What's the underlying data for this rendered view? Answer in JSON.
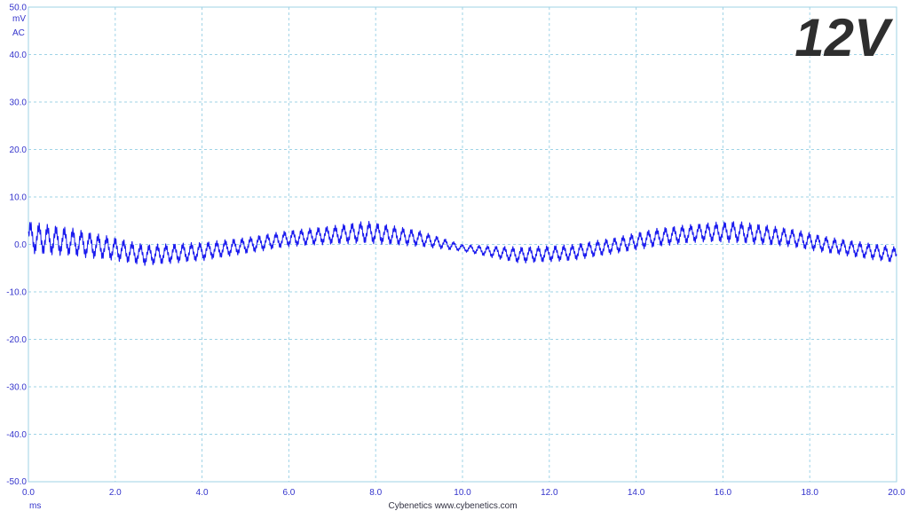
{
  "chart_data": {
    "type": "line",
    "title": "12V",
    "xlabel": "ms",
    "ylabel": "mV",
    "ylabel_mode": "AC",
    "xlim": [
      0,
      20
    ],
    "ylim": [
      -50,
      50
    ],
    "x_ticks": [
      "0.0",
      "2.0",
      "4.0",
      "6.0",
      "8.0",
      "10.0",
      "12.0",
      "14.0",
      "16.0",
      "18.0",
      "20.0"
    ],
    "y_ticks": [
      "50.0",
      "40.0",
      "30.0",
      "20.0",
      "10.0",
      "0.0",
      "-10.0",
      "-20.0",
      "-30.0",
      "-40.0",
      "-50.0"
    ],
    "grid": true,
    "footer": "Cybenetics  www.cybenetics.com",
    "series_color": "#1a1aee",
    "grid_color": "#9fd3e6",
    "ripple_envelope": {
      "x": [
        0.0,
        1.0,
        2.0,
        2.7,
        4.0,
        5.0,
        6.0,
        7.0,
        7.8,
        9.0,
        10.0,
        11.3,
        12.5,
        13.5,
        14.5,
        15.5,
        16.3,
        17.5,
        18.5,
        20.0
      ],
      "low": [
        -2.0,
        -2.5,
        -3.5,
        -4.5,
        -3.5,
        -2.0,
        -0.5,
        0.0,
        0.2,
        -0.5,
        -1.5,
        -4.0,
        -3.5,
        -2.0,
        -0.5,
        0.5,
        0.3,
        -0.5,
        -2.0,
        -4.0
      ],
      "high": [
        5.0,
        3.5,
        1.5,
        0.0,
        0.5,
        1.5,
        3.0,
        4.0,
        5.0,
        3.0,
        0.0,
        -0.5,
        0.0,
        1.5,
        3.5,
        4.5,
        5.0,
        3.5,
        1.5,
        -0.5
      ]
    }
  }
}
